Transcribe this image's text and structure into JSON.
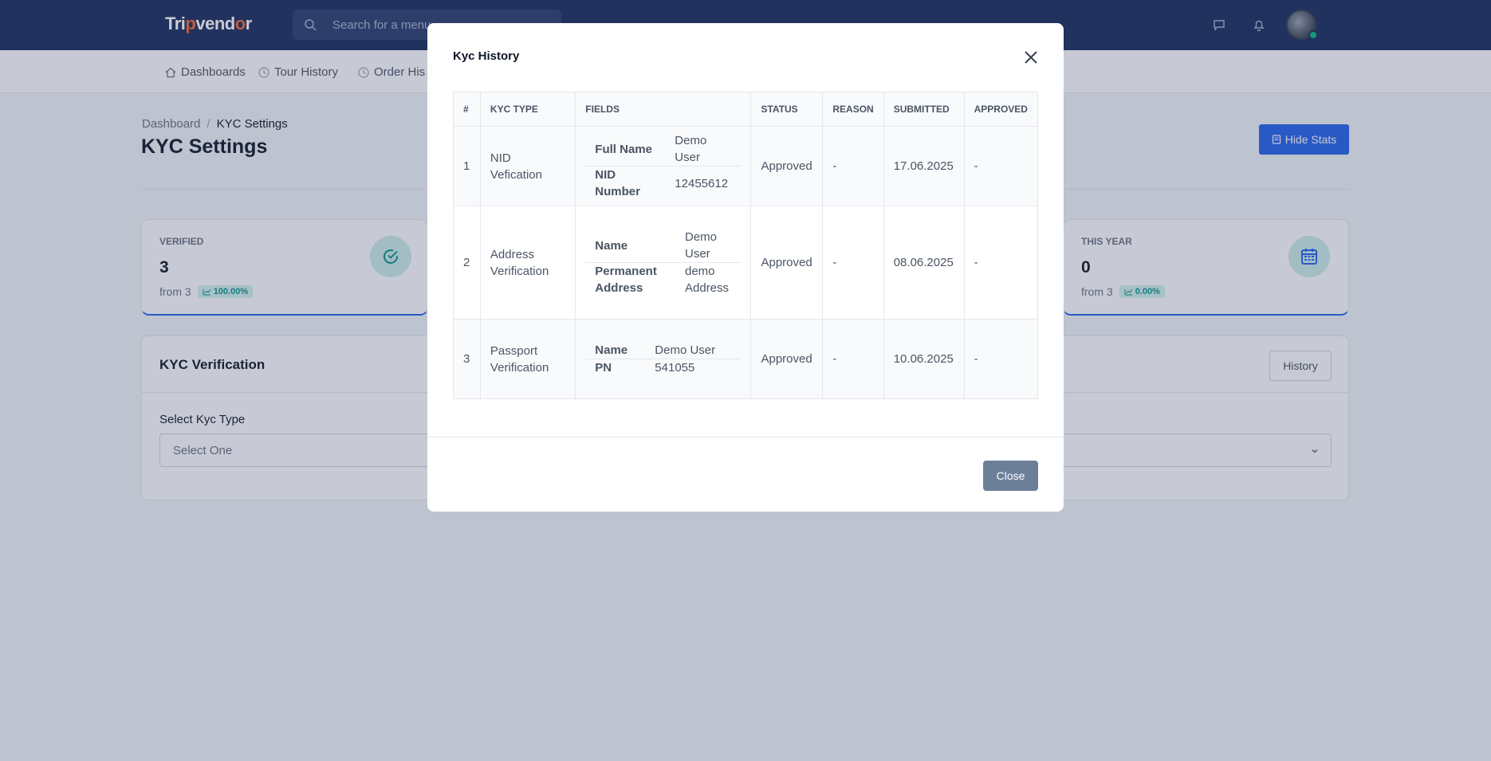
{
  "topbar": {
    "logo_pre": "Tri",
    "logo_mid": "p",
    "logo_post": "vend",
    "logo_o": "o",
    "logo_end": "r",
    "search_placeholder": "Search for a menu"
  },
  "nav": {
    "items": [
      {
        "label": "Dashboards",
        "icon": "home-icon"
      },
      {
        "label": "Tour History",
        "icon": "clock-icon"
      },
      {
        "label": "Order His",
        "icon": "clock-icon"
      }
    ]
  },
  "page": {
    "breadcrumb": {
      "root": "Dashboard",
      "separator": "/",
      "current": "KYC Settings"
    },
    "title": "KYC Settings",
    "hide_stats_label": "Hide Stats"
  },
  "stats": [
    {
      "label": "VERIFIED",
      "value": "3",
      "from": "from 3",
      "pct": "100.00%",
      "icon": "check-circle-icon"
    },
    {
      "label": "THIS YEAR",
      "value": "0",
      "from": "from 3",
      "pct": "0.00%",
      "icon": "calendar-icon"
    }
  ],
  "kyc_card": {
    "title": "KYC Verification",
    "history_label": "History",
    "field_label": "Select Kyc Type",
    "select_value": "Select One"
  },
  "modal": {
    "title": "Kyc History",
    "close_label": "Close",
    "columns": [
      "#",
      "KYC TYPE",
      "FIELDS",
      "STATUS",
      "REASON",
      "SUBMITTED",
      "APPROVED"
    ],
    "rows": [
      {
        "num": "1",
        "type": "NID Vefication",
        "fields": [
          {
            "k": "Full Name",
            "v": "Demo User"
          },
          {
            "k": "NID Number",
            "v": "12455612"
          }
        ],
        "status": "Approved",
        "reason": "-",
        "submitted": "17.06.2025",
        "approved": "-"
      },
      {
        "num": "2",
        "type": "Address Verification",
        "fields": [
          {
            "k": "Name",
            "v": "Demo User"
          },
          {
            "k": "Permanent Address",
            "v": "demo Address"
          }
        ],
        "status": "Approved",
        "reason": "-",
        "submitted": "08.06.2025",
        "approved": "-"
      },
      {
        "num": "3",
        "type": "Passport Verification",
        "fields": [
          {
            "k": "Name",
            "v": "Demo User"
          },
          {
            "k": "PN",
            "v": "541055"
          }
        ],
        "status": "Approved",
        "reason": "-",
        "submitted": "10.06.2025",
        "approved": "-"
      }
    ]
  },
  "colors": {
    "topbar": "#1b2d5c",
    "primary": "#2563eb",
    "teal": "#0d9488",
    "close_button": "#6b7f99"
  }
}
